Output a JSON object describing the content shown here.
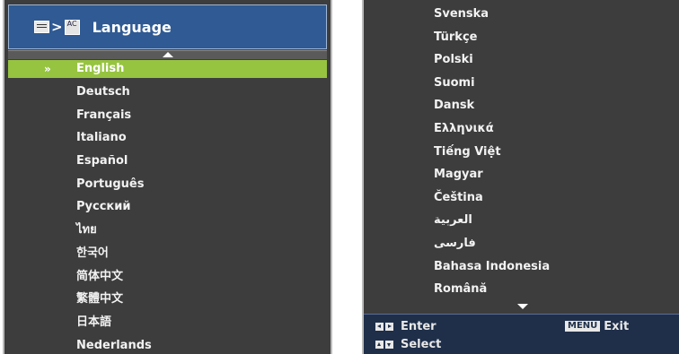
{
  "header": {
    "menu_icon": "menu-icon",
    "separator": ">",
    "lang_icon": "language-icon",
    "lang_icon_glyph": "AC",
    "title": "Language"
  },
  "left_list": {
    "selected_marker": "»",
    "items": [
      {
        "label": "English",
        "selected": true
      },
      {
        "label": "Deutsch"
      },
      {
        "label": "Français"
      },
      {
        "label": "Italiano"
      },
      {
        "label": "Español"
      },
      {
        "label": "Português"
      },
      {
        "label": "Русский"
      },
      {
        "label": "ไทย"
      },
      {
        "label": "한국어"
      },
      {
        "label": "简体中文"
      },
      {
        "label": "繁體中文"
      },
      {
        "label": "日本語"
      },
      {
        "label": "Nederlands"
      }
    ]
  },
  "right_list": {
    "items": [
      {
        "label": "Svenska"
      },
      {
        "label": "Türkçe"
      },
      {
        "label": "Polski"
      },
      {
        "label": "Suomi"
      },
      {
        "label": "Dansk"
      },
      {
        "label": "Ελληνικά"
      },
      {
        "label": "Tiếng Việt"
      },
      {
        "label": "Magyar"
      },
      {
        "label": "Čeština"
      },
      {
        "label": "العربية"
      },
      {
        "label": "فارسی"
      },
      {
        "label": "Bahasa Indonesia"
      },
      {
        "label": "Română"
      }
    ]
  },
  "footer": {
    "enter_label": "Enter",
    "select_label": "Select",
    "menu_key": "MENU",
    "exit_label": "Exit"
  },
  "colors": {
    "panel_bg": "#3d3d3d",
    "header_bg": "#2f5a93",
    "selected_bg": "#96c440",
    "footer_bg": "#1f2f4a"
  }
}
